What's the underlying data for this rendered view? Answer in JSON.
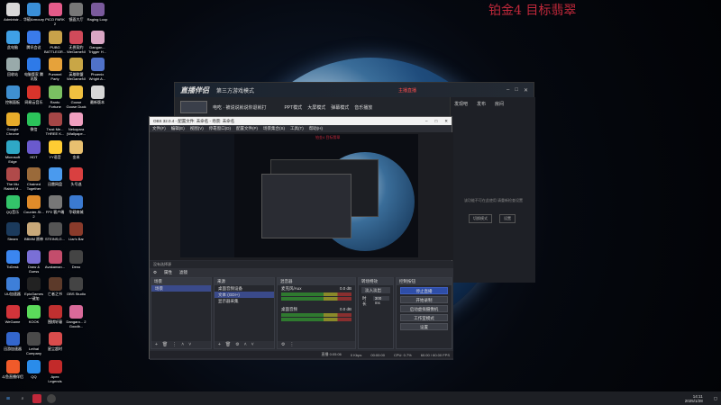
{
  "overlay_text": "铂金4 目标翡翠",
  "desktop_icons": [
    {
      "label": "Administr...",
      "color": "#d8d8d8"
    },
    {
      "label": "华硕Armoury",
      "color": "#3a8fd8"
    },
    {
      "label": "PICO PARK 2",
      "color": "#e45b8a"
    },
    {
      "label": "镜面大厅",
      "color": "#777"
    },
    {
      "label": "Raging Loop",
      "color": "#7a5a9c"
    },
    {
      "label": "此电脑",
      "color": "#3fa0e6"
    },
    {
      "label": "腾讯会议",
      "color": "#3a7bea"
    },
    {
      "label": "PUBG BATTLEGR...",
      "color": "#c8a24a"
    },
    {
      "label": "无畏契约 WeGameNI",
      "color": "#d04a5a"
    },
    {
      "label": "Dangan... Trigger H...",
      "color": "#d9a6c4"
    },
    {
      "label": "回收站",
      "color": "#9aa"
    },
    {
      "label": "电脑管家 腾讯版",
      "color": "#2e7ae8"
    },
    {
      "label": "Pummel Party",
      "color": "#e6a23a"
    },
    {
      "label": "英雄联盟 WeGameNI",
      "color": "#c9a646"
    },
    {
      "label": "Phoenix Wright A...",
      "color": "#5072c8"
    },
    {
      "label": "控制面板",
      "color": "#3f8fd0"
    },
    {
      "label": "网易云音乐",
      "color": "#d9342b"
    },
    {
      "label": "Ranto Fortune",
      "color": "#7ac062"
    },
    {
      "label": "Goose Goose Duck",
      "color": "#f0c040"
    },
    {
      "label": "最新版本",
      "color": "#d6d6d6"
    },
    {
      "label": "Google Chrome",
      "color": "#e8ac2a"
    },
    {
      "label": "微信",
      "color": "#2bc35a"
    },
    {
      "label": "Trust Me... THREE K...",
      "color": "#a54646"
    },
    {
      "label": "Nekopara (Wallpape...",
      "color": "#f0a0c0"
    },
    {
      "label": "",
      "color": "#000"
    },
    {
      "label": "Microsoft Edge",
      "color": "#2fa8c6"
    },
    {
      "label": "HDT",
      "color": "#6a5acd"
    },
    {
      "label": "YY语音",
      "color": "#ffcc33"
    },
    {
      "label": "金米",
      "color": "#e8c070"
    },
    {
      "label": "",
      "color": "#000"
    },
    {
      "label": "The Mu Rabbit M...",
      "color": "#b04a4a"
    },
    {
      "label": "Chained Together",
      "color": "#9a6a3a"
    },
    {
      "label": "迅雷网盘",
      "color": "#4a9aee"
    },
    {
      "label": "头号逃",
      "color": "#d94040"
    },
    {
      "label": "",
      "color": "#000"
    },
    {
      "label": "QQ音乐",
      "color": "#33c46a"
    },
    {
      "label": "Counter-St... 2",
      "color": "#e08b2a"
    },
    {
      "label": "FP2 客户端",
      "color": "#777"
    },
    {
      "label": "华硕商城",
      "color": "#3b7ad1"
    },
    {
      "label": "",
      "color": "#000"
    },
    {
      "label": "Steam",
      "color": "#1b3a5c"
    },
    {
      "label": "BBMM 原神",
      "color": "#c9a97a"
    },
    {
      "label": "STEINS;G...",
      "color": "#555"
    },
    {
      "label": "Liar's Bar",
      "color": "#8a3b2b"
    },
    {
      "label": "",
      "color": "#000"
    },
    {
      "label": "ToDesk",
      "color": "#3b86f0"
    },
    {
      "label": "Draw & Guess",
      "color": "#7a6fd6"
    },
    {
      "label": "Avakaman...",
      "color": "#c34d6c"
    },
    {
      "label": "Deno",
      "color": "#444"
    },
    {
      "label": "",
      "color": "#000"
    },
    {
      "label": "UU加速器",
      "color": "#3e7fd9"
    },
    {
      "label": "EpicGames 一键加",
      "color": "#222"
    },
    {
      "label": "亡者之书",
      "color": "#5c3a2a"
    },
    {
      "label": "OBS Studio",
      "color": "#444"
    },
    {
      "label": "",
      "color": "#000"
    },
    {
      "label": "WeGame",
      "color": "#d2343a"
    },
    {
      "label": "KOOK",
      "color": "#5bdb5b"
    },
    {
      "label": "围棋轩辕",
      "color": "#c03030"
    },
    {
      "label": "Dangaro... 2 Goodb...",
      "color": "#d96a9a"
    },
    {
      "label": "",
      "color": "#000"
    },
    {
      "label": "迅游加速器",
      "color": "#3366cc"
    },
    {
      "label": "Lethal Company",
      "color": "#4a4a4a"
    },
    {
      "label": "星尘超时",
      "color": "#d94c4c"
    },
    {
      "label": "",
      "color": "#000"
    },
    {
      "label": "",
      "color": "#000"
    },
    {
      "label": "斗鱼直播伴侣",
      "color": "#f05a2a"
    },
    {
      "label": "QQ",
      "color": "#2a8cea"
    },
    {
      "label": "Apex Legends",
      "color": "#c22a2a"
    },
    {
      "label": "",
      "color": "#000"
    },
    {
      "label": "",
      "color": "#000"
    }
  ],
  "live_app": {
    "logo": "直播伴侣",
    "subtitle": "第三方游戏模式",
    "stream_title": "电吃 · 被说说就说你退就打",
    "record_label": "主播直播",
    "tab_discover": "发现吧",
    "tab_anchor": "发布",
    "tab_room": "房间",
    "side_message": "该功能不可在此使用 请重新检查设置",
    "side_btn_a": "切换模式",
    "side_btn_b": "设置",
    "toggle_a": "PPT模式",
    "toggle_b": "大屏模式",
    "toggle_c": "弹幕模式",
    "toggle_d": "音乐播放"
  },
  "obs": {
    "title": "OBS 32.0.4 - 配置文件: 未命名 - 场景: 未命名",
    "menu": [
      "文件(F)",
      "编辑(E)",
      "视图(V)",
      "停靠窗口(D)",
      "配置文件(P)",
      "场景集合(S)",
      "工具(T)",
      "帮助(H)"
    ],
    "status_text": "没有选择源",
    "toolbar_props": "属性",
    "toolbar_filter": "滤镜",
    "docks": {
      "scenes": {
        "title": "场景",
        "items": [
          "场景"
        ]
      },
      "sources": {
        "title": "来源",
        "items": [
          "桌面音频设备",
          "文本 (GDI+)",
          "显示器采集"
        ]
      },
      "mixer": {
        "title": "混音器",
        "channels": [
          {
            "name": "麦克风/Aux",
            "db": "0.0 dB"
          },
          {
            "name": "桌面音频",
            "db": "0.0 dB"
          }
        ]
      },
      "transitions": {
        "title": "转场特效",
        "type": "淡入淡出",
        "duration_label": "时长",
        "duration": "300 ms"
      },
      "controls": {
        "title": "控制按钮",
        "buttons": [
          "停止直播",
          "开始录制",
          "启动虚拟摄像机",
          "工作室模式",
          "设置"
        ]
      }
    },
    "status": {
      "live": "直播 0:05:06",
      "rec": "0 Kbps",
      "time": "00:00:00",
      "cpu": "CPU: 0.7%",
      "fps": "60.00 / 60.00 FPS"
    }
  },
  "taskbar": {
    "time": "14:11",
    "date": "2025/1/28"
  }
}
